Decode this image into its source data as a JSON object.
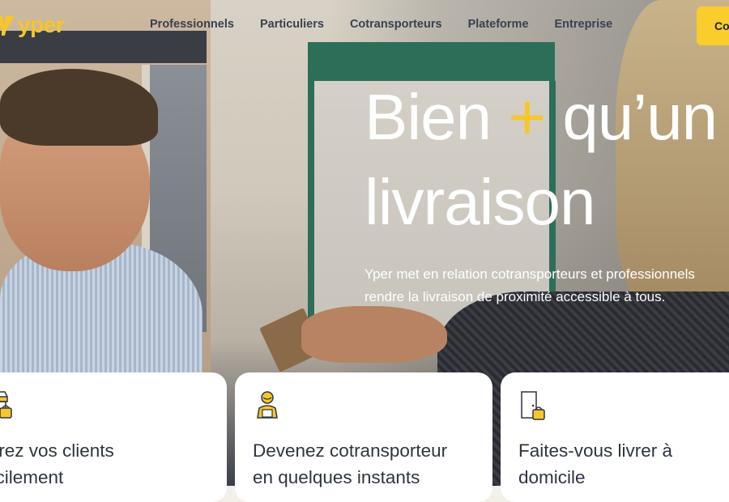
{
  "brand": {
    "name": "yper",
    "accent_color": "#f6c62a"
  },
  "nav": {
    "items": [
      {
        "label": "Professionnels"
      },
      {
        "label": "Particuliers"
      },
      {
        "label": "Cotransporteurs"
      },
      {
        "label": "Plateforme"
      },
      {
        "label": "Entreprise"
      }
    ],
    "cta_label": "Co"
  },
  "hero": {
    "headline_part1": "Bien",
    "headline_plus": "+",
    "headline_part2": "qu’un",
    "headline_line2": "livraison",
    "subtitle_line1": "Yper met en relation cotransporteurs et professionnels",
    "subtitle_line2": "rendre la livraison de proximité accessible à tous."
  },
  "cards": [
    {
      "icon": "shop-bag-icon",
      "title_line1": "ivrez vos clients",
      "title_line2": "acilement"
    },
    {
      "icon": "courier-person-icon",
      "title_line1": "Devenez cotransporteur",
      "title_line2": "en quelques instants"
    },
    {
      "icon": "door-bag-icon",
      "title_line1": "Faites-vous livrer à",
      "title_line2": "domicile"
    }
  ]
}
